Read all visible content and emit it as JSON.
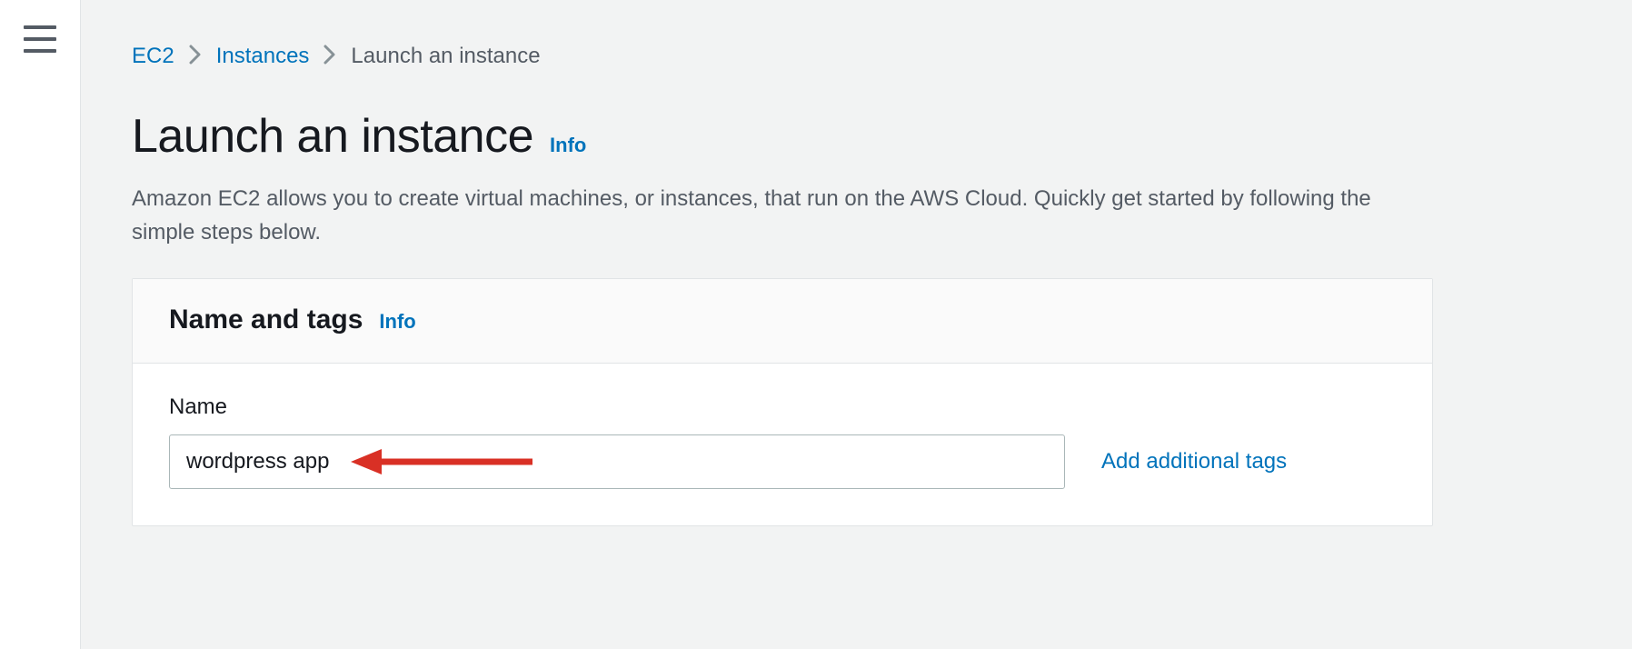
{
  "breadcrumb": {
    "items": [
      {
        "label": "EC2"
      },
      {
        "label": "Instances"
      }
    ],
    "current": "Launch an instance"
  },
  "header": {
    "title": "Launch an instance",
    "info_label": "Info",
    "description": "Amazon EC2 allows you to create virtual machines, or instances, that run on the AWS Cloud. Quickly get started by following the simple steps below."
  },
  "panel": {
    "title": "Name and tags",
    "info_label": "Info",
    "name_field": {
      "label": "Name",
      "value": "wordpress app"
    },
    "add_tags_label": "Add additional tags"
  },
  "annotation": {
    "arrow_color": "#d93025"
  }
}
